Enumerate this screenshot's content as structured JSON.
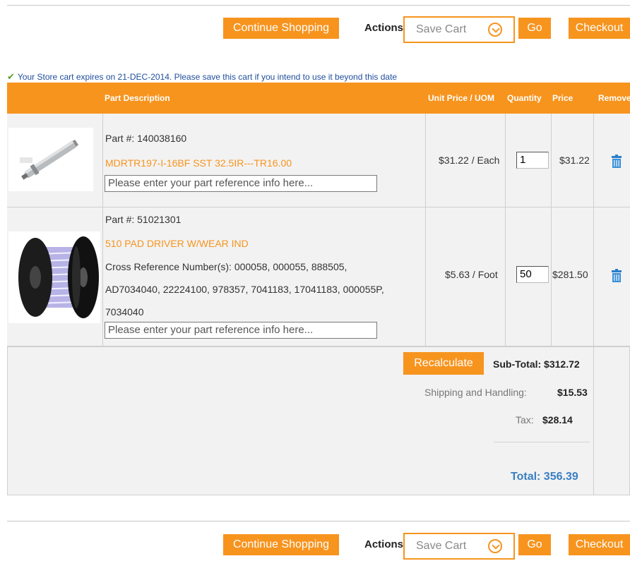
{
  "action_bar": {
    "continue_label": "Continue Shopping",
    "actions_label": "Actions",
    "save_cart_label": "Save Cart",
    "go_label": "Go",
    "checkout_label": "Checkout"
  },
  "expiry_notice": "Your Store cart expires on 21-DEC-2014. Please save this cart if you intend to use it beyond this date",
  "table": {
    "headers": {
      "description": "Part Description",
      "unit_price": "Unit Price / UOM",
      "quantity": "Quantity",
      "price": "Price",
      "remove": "Remove"
    },
    "items": [
      {
        "part_number": "Part #: 140038160",
        "title": "MDRTR197-I-16BF SST 32.5IR---TR16.00",
        "ref_placeholder": "Please enter your part reference info here...",
        "unit_price": "$31.22 / Each",
        "quantity": "1",
        "price": "$31.22"
      },
      {
        "part_number": "Part #: 51021301",
        "title": "510 PAD DRIVER W/WEAR IND",
        "cross_ref_line1": "Cross Reference Number(s): 000058, 000055, 888505,",
        "cross_ref_line2": "AD7034040, 22224100, 978357, 7041183, 17041183, 000055P,",
        "cross_ref_line3": "7034040",
        "ref_placeholder": "Please enter your part reference info here...",
        "unit_price": "$5.63 / Foot",
        "quantity": "50",
        "price": "$281.50"
      }
    ]
  },
  "totals": {
    "recalculate_label": "Recalculate",
    "subtotal": "Sub-Total: $312.72",
    "shipping_label": "Shipping and Handling:",
    "shipping_value": "$15.53",
    "tax_label": "Tax:",
    "tax_value": "$28.14",
    "total": "Total: 356.39"
  },
  "colors": {
    "accent": "#f7941e",
    "link_blue": "#1f4e9c",
    "total_blue": "#3a7fc1"
  },
  "icons": [
    "checkmark-icon",
    "chevron-down-icon",
    "trash-icon"
  ]
}
